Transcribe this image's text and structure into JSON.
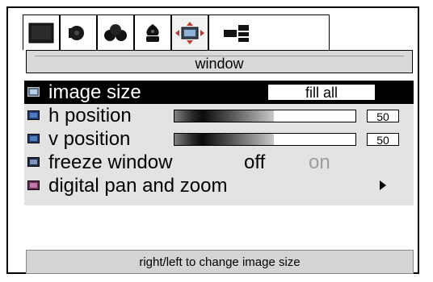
{
  "tabs": [
    {
      "icon": "monitor-icon"
    },
    {
      "icon": "speaker-icon"
    },
    {
      "icon": "color-circles-icon"
    },
    {
      "icon": "fan-icon"
    },
    {
      "icon": "window-move-icon",
      "active": true
    },
    {
      "icon": "setup-grid-icon"
    }
  ],
  "title": "window",
  "menu": {
    "items": [
      {
        "label": "image size",
        "value": "fill all",
        "selected": true
      },
      {
        "label": "h position",
        "value": "50",
        "level": 0.55
      },
      {
        "label": "v position",
        "value": "50",
        "level": 0.55
      },
      {
        "label": "freeze window",
        "options": [
          "off",
          "on"
        ],
        "current": "off"
      },
      {
        "label": "digital pan and zoom",
        "submenu": true
      }
    ]
  },
  "hint": "right/left to change image size"
}
